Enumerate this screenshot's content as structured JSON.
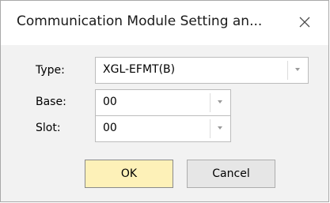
{
  "dialog": {
    "title": "Communication Module Setting an...",
    "close_icon": "close-icon"
  },
  "fields": {
    "type": {
      "label": "Type:",
      "value": "XGL-EFMT(B)"
    },
    "base": {
      "label": "Base:",
      "value": "00"
    },
    "slot": {
      "label": "Slot:",
      "value": "00"
    }
  },
  "buttons": {
    "ok_label": "OK",
    "cancel_label": "Cancel"
  },
  "colors": {
    "ok_button_background": "#fdf1b8",
    "dialog_background": "#f2f2f2"
  }
}
